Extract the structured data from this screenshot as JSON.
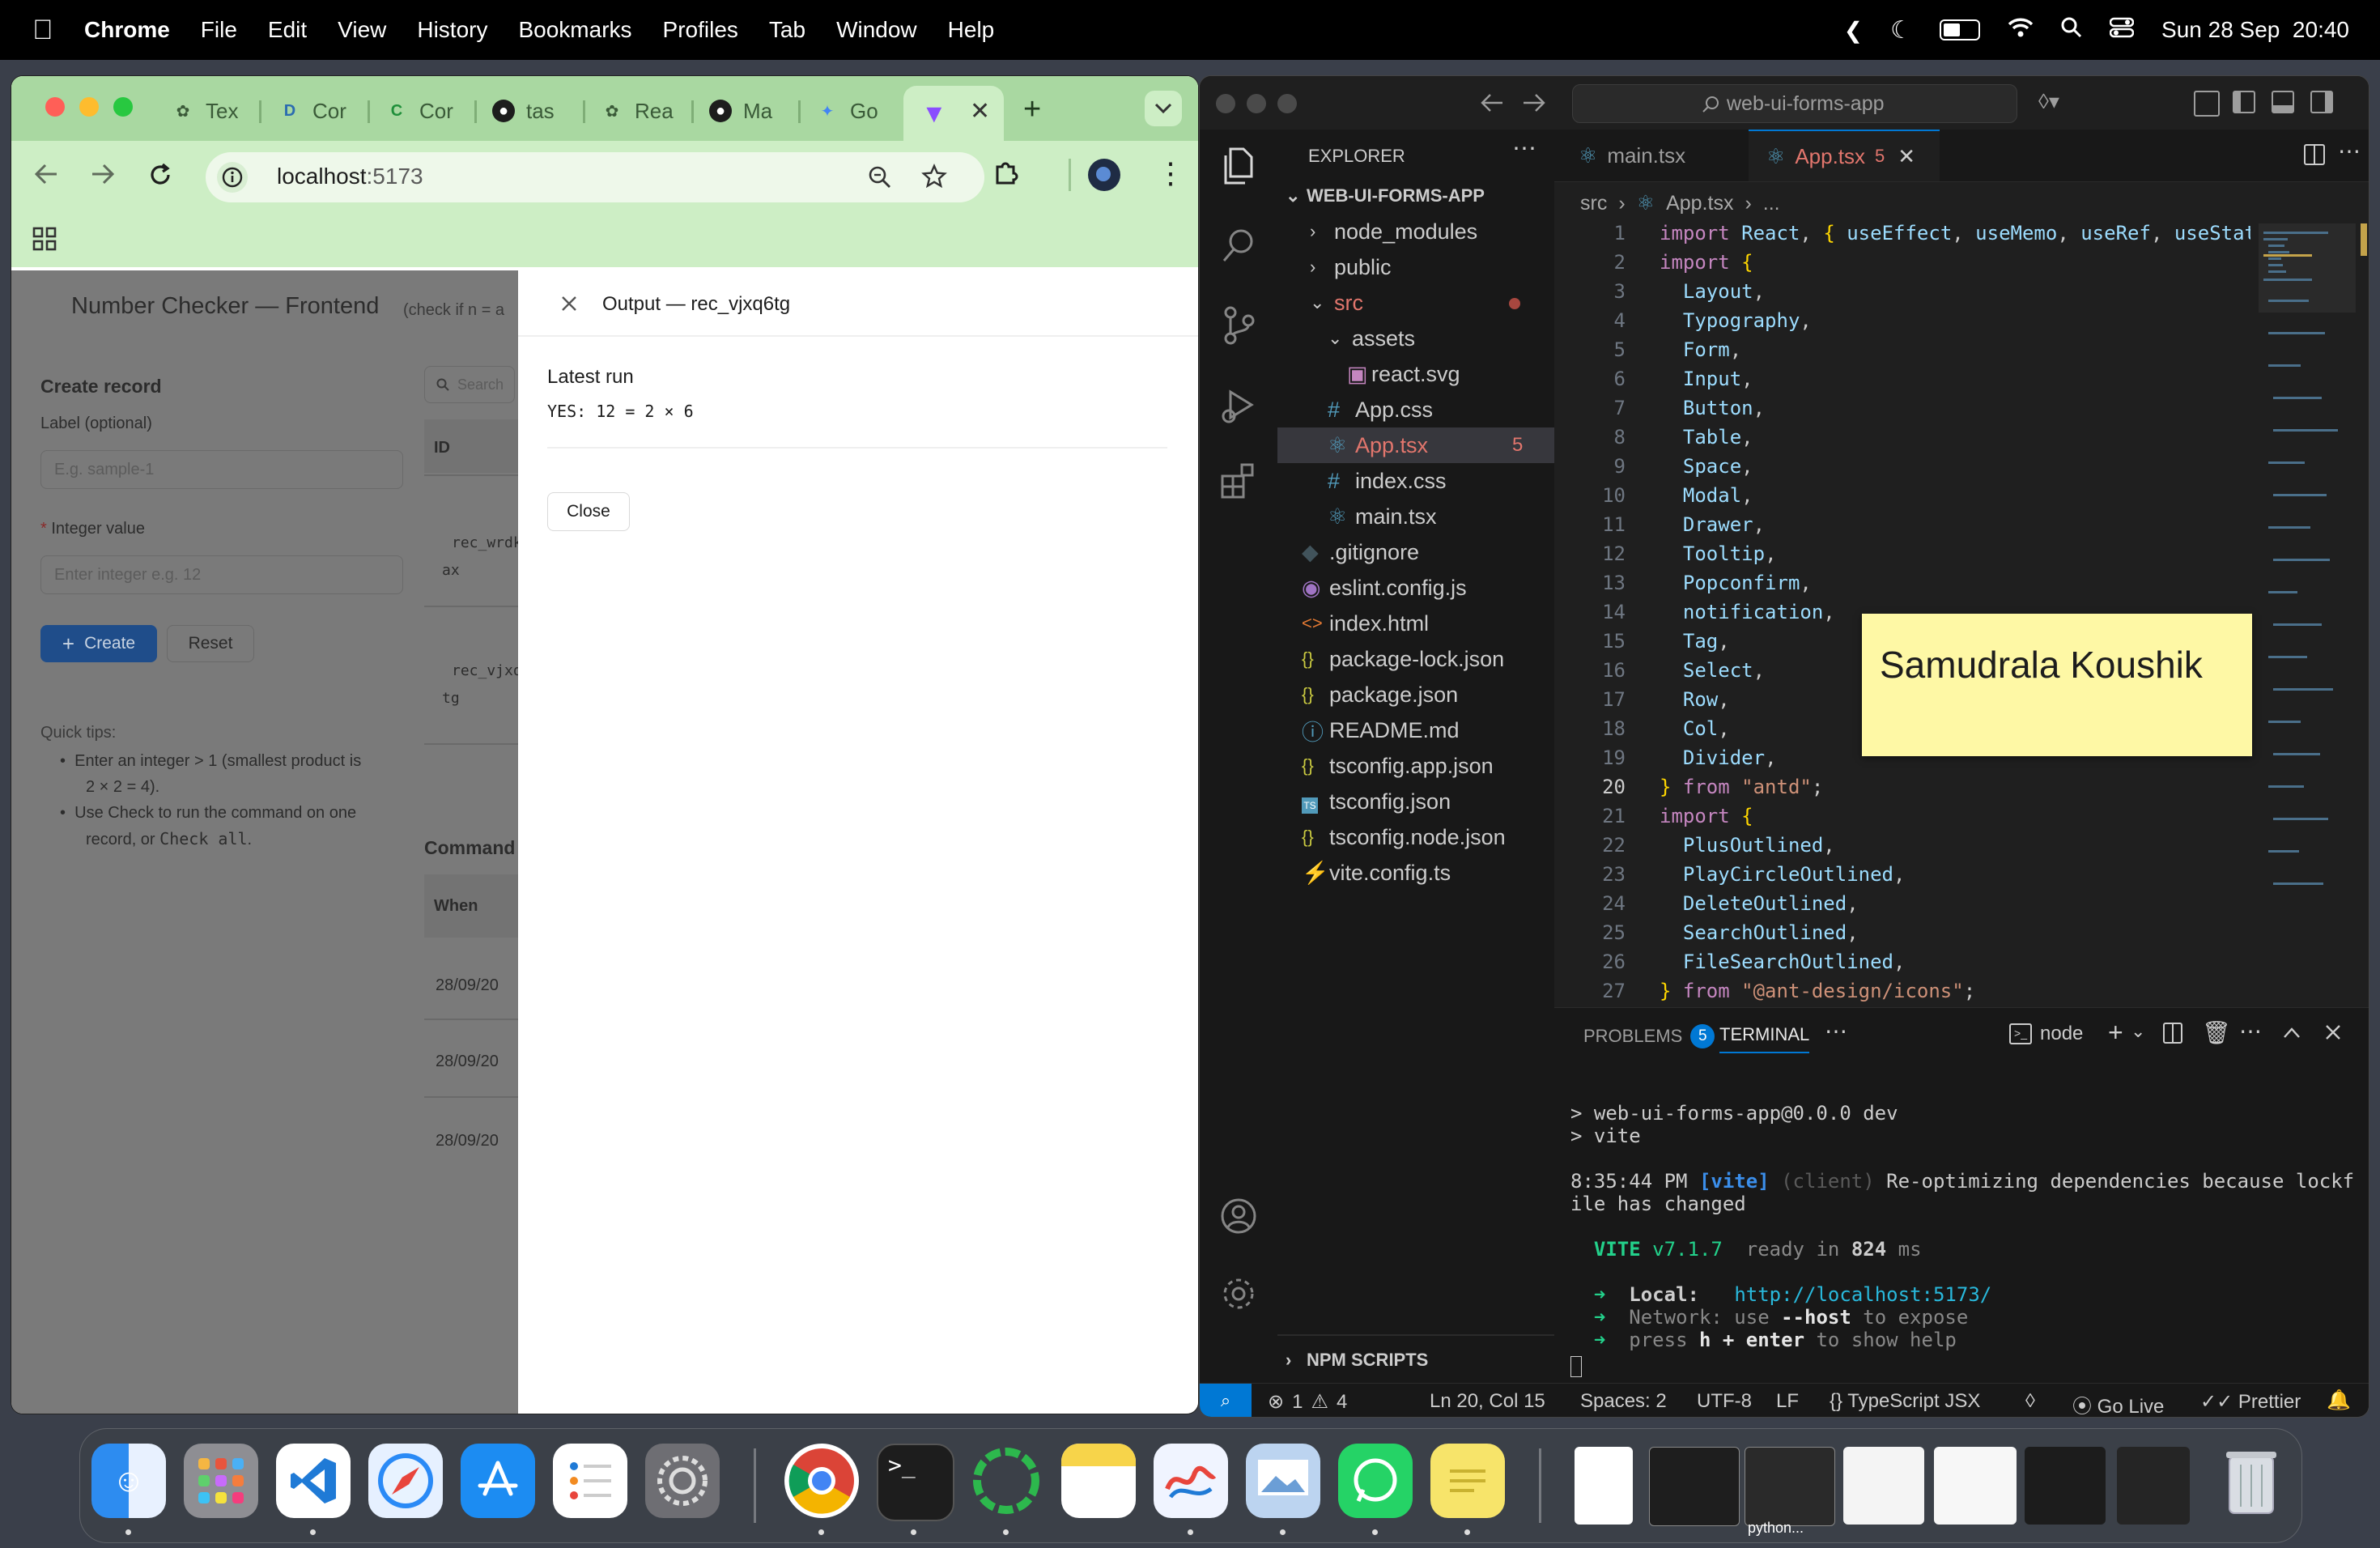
{
  "menubar": {
    "app": "Chrome",
    "items": [
      "File",
      "Edit",
      "View",
      "History",
      "Bookmarks",
      "Profiles",
      "Tab",
      "Window",
      "Help"
    ],
    "clock": "Sun 28 Sep  20:40"
  },
  "chrome": {
    "tabs": [
      "Tex",
      "Cor",
      "Cor",
      "tas",
      "Rea",
      "Ma",
      "Go"
    ],
    "url_host": "localhost",
    "url_port": ":5173"
  },
  "app": {
    "title": "Number Checker — Frontend",
    "subtitle": "(check if n = a",
    "create_heading": "Create record",
    "label_field_label": "Label (optional)",
    "label_placeholder": "E.g. sample-1",
    "integer_field_label": "Integer value",
    "required_mark": "*",
    "integer_placeholder": "Enter integer e.g. 12",
    "create_button": "Create",
    "reset_button": "Reset",
    "tips_heading": "Quick tips:",
    "tip1_line1": "Enter an integer > 1 (smallest product is",
    "tip1_line2": "2 × 2 = 4).",
    "tip2_line1": "Use Check to run the command on one",
    "tip2_line2_a": "record, or ",
    "tip2_line2_b": "Check all",
    "tip2_line2_c": ".",
    "search_placeholder": "Search",
    "table_id_header": "ID",
    "row1_id": "rec_wrdk",
    "row1_id2": "ax",
    "row2_id": "rec_vjxq",
    "row2_id2": "tg",
    "commands_heading": "Command",
    "when_header": "When",
    "when_rows": [
      "28/09/20",
      "28/09/20",
      "28/09/20"
    ]
  },
  "modal": {
    "title": "Output — rec_vjxq6tg",
    "latest_run": "Latest run",
    "output": "YES: 12 = 2 × 6",
    "close_button": "Close"
  },
  "vscode": {
    "search": "web-ui-forms-app",
    "explorer_title": "EXPLORER",
    "project": "WEB-UI-FORMS-APP",
    "tree": {
      "node_modules": "node_modules",
      "public": "public",
      "src": "src",
      "assets": "assets",
      "react_svg": "react.svg",
      "app_css": "App.css",
      "app_tsx": "App.tsx",
      "app_tsx_badge": "5",
      "index_css": "index.css",
      "main_tsx": "main.tsx",
      "gitignore": ".gitignore",
      "eslint": "eslint.config.js",
      "index_html": "index.html",
      "package_lock": "package-lock.json",
      "package_json": "package.json",
      "readme": "README.md",
      "tsconfig_app": "tsconfig.app.json",
      "tsconfig": "tsconfig.json",
      "tsconfig_node": "tsconfig.node.json",
      "vite_config": "vite.config.ts"
    },
    "npm_scripts": "NPM SCRIPTS",
    "tab_main": "main.tsx",
    "tab_app": "App.tsx",
    "tab_app_badge": "5",
    "breadcrumb_src": "src",
    "breadcrumb_file": "App.tsx",
    "breadcrumb_more": "...",
    "code": [
      {
        "n": "1",
        "parts": [
          [
            "kw",
            "import "
          ],
          [
            "id",
            "React"
          ],
          [
            "pn",
            ", "
          ],
          [
            "br",
            "{ "
          ],
          [
            "id",
            "useEffect"
          ],
          [
            "pn",
            ", "
          ],
          [
            "id",
            "useMemo"
          ],
          [
            "pn",
            ", "
          ],
          [
            "id",
            "useRef"
          ],
          [
            "pn",
            ", "
          ],
          [
            "id",
            "useStat"
          ]
        ]
      },
      {
        "n": "2",
        "parts": [
          [
            "kw",
            "import "
          ],
          [
            "br",
            "{"
          ]
        ]
      },
      {
        "n": "3",
        "parts": [
          [
            "pn",
            "  "
          ],
          [
            "id",
            "Layout"
          ],
          [
            "pn",
            ","
          ]
        ]
      },
      {
        "n": "4",
        "parts": [
          [
            "pn",
            "  "
          ],
          [
            "id",
            "Typography"
          ],
          [
            "pn",
            ","
          ]
        ]
      },
      {
        "n": "5",
        "parts": [
          [
            "pn",
            "  "
          ],
          [
            "id",
            "Form"
          ],
          [
            "pn",
            ","
          ]
        ]
      },
      {
        "n": "6",
        "parts": [
          [
            "pn",
            "  "
          ],
          [
            "id",
            "Input"
          ],
          [
            "pn",
            ","
          ]
        ]
      },
      {
        "n": "7",
        "parts": [
          [
            "pn",
            "  "
          ],
          [
            "id",
            "Button"
          ],
          [
            "pn",
            ","
          ]
        ]
      },
      {
        "n": "8",
        "parts": [
          [
            "pn",
            "  "
          ],
          [
            "id",
            "Table"
          ],
          [
            "pn",
            ","
          ]
        ]
      },
      {
        "n": "9",
        "parts": [
          [
            "pn",
            "  "
          ],
          [
            "id",
            "Space"
          ],
          [
            "pn",
            ","
          ]
        ]
      },
      {
        "n": "10",
        "parts": [
          [
            "pn",
            "  "
          ],
          [
            "id",
            "Modal"
          ],
          [
            "pn",
            ","
          ]
        ]
      },
      {
        "n": "11",
        "parts": [
          [
            "pn",
            "  "
          ],
          [
            "id",
            "Drawer"
          ],
          [
            "pn",
            ","
          ]
        ]
      },
      {
        "n": "12",
        "parts": [
          [
            "pn",
            "  "
          ],
          [
            "id",
            "Tooltip"
          ],
          [
            "pn",
            ","
          ]
        ]
      },
      {
        "n": "13",
        "parts": [
          [
            "pn",
            "  "
          ],
          [
            "id",
            "Popconfirm"
          ],
          [
            "pn",
            ","
          ]
        ]
      },
      {
        "n": "14",
        "parts": [
          [
            "pn",
            "  "
          ],
          [
            "id",
            "notification"
          ],
          [
            "pn",
            ","
          ]
        ]
      },
      {
        "n": "15",
        "parts": [
          [
            "pn",
            "  "
          ],
          [
            "id",
            "Tag"
          ],
          [
            "pn",
            ","
          ]
        ]
      },
      {
        "n": "16",
        "parts": [
          [
            "pn",
            "  "
          ],
          [
            "id",
            "Select"
          ],
          [
            "pn",
            ","
          ]
        ]
      },
      {
        "n": "17",
        "parts": [
          [
            "pn",
            "  "
          ],
          [
            "id",
            "Row"
          ],
          [
            "pn",
            ","
          ]
        ]
      },
      {
        "n": "18",
        "parts": [
          [
            "pn",
            "  "
          ],
          [
            "id",
            "Col"
          ],
          [
            "pn",
            ","
          ]
        ]
      },
      {
        "n": "19",
        "parts": [
          [
            "pn",
            "  "
          ],
          [
            "id",
            "Divider"
          ],
          [
            "pn",
            ","
          ]
        ]
      },
      {
        "n": "20",
        "parts": [
          [
            "br",
            "} "
          ],
          [
            "kw",
            "from "
          ],
          [
            "str",
            "\"antd\""
          ],
          [
            "pn",
            ";"
          ]
        ]
      },
      {
        "n": "21",
        "parts": [
          [
            "kw",
            "import "
          ],
          [
            "br",
            "{"
          ]
        ]
      },
      {
        "n": "22",
        "parts": [
          [
            "pn",
            "  "
          ],
          [
            "id",
            "PlusOutlined"
          ],
          [
            "pn",
            ","
          ]
        ]
      },
      {
        "n": "23",
        "parts": [
          [
            "pn",
            "  "
          ],
          [
            "id",
            "PlayCircleOutlined"
          ],
          [
            "pn",
            ","
          ]
        ]
      },
      {
        "n": "24",
        "parts": [
          [
            "pn",
            "  "
          ],
          [
            "id",
            "DeleteOutlined"
          ],
          [
            "pn",
            ","
          ]
        ]
      },
      {
        "n": "25",
        "parts": [
          [
            "pn",
            "  "
          ],
          [
            "id",
            "SearchOutlined"
          ],
          [
            "pn",
            ","
          ]
        ]
      },
      {
        "n": "26",
        "parts": [
          [
            "pn",
            "  "
          ],
          [
            "id",
            "FileSearchOutlined"
          ],
          [
            "pn",
            ","
          ]
        ]
      },
      {
        "n": "27",
        "parts": [
          [
            "br",
            "} "
          ],
          [
            "kw",
            "from "
          ],
          [
            "str",
            "\"@ant-design/icons\""
          ],
          [
            "pn",
            ";"
          ]
        ]
      }
    ],
    "sticky_note": "Samudrala Koushik",
    "panel_problems": "PROBLEMS",
    "panel_problems_count": "5",
    "panel_terminal": "TERMINAL",
    "panel_shell": "node",
    "terminal": {
      "l1": "> web-ui-forms-app@0.0.0 dev",
      "l2": "> vite",
      "l3_time": "8:35:44 PM ",
      "l3_tag": "[vite]",
      "l3_client": " (client) ",
      "l3_msg": "Re-optimizing dependencies because lockf",
      "l4": "ile has changed",
      "vite": "VITE",
      "vite_ver": " v7.1.7",
      "ready": "  ready in ",
      "ready_ms": "824",
      "ready_unit": " ms",
      "local_label": "Local:",
      "local_url": "http://localhost:5173/",
      "network_label": "Network:",
      "network_a": " use ",
      "network_b": "--host",
      "network_c": " to expose",
      "help_a": "press ",
      "help_b": "h + enter",
      "help_c": " to show help"
    },
    "status": {
      "errors": "1",
      "warnings": "4",
      "position": "Ln 20, Col 15",
      "spaces": "Spaces: 2",
      "encoding": "UTF-8",
      "eol": "LF",
      "language": "TypeScript JSX",
      "golive": "Go Live",
      "prettier": "Prettier"
    }
  },
  "dock": {
    "python_label": "python..."
  }
}
